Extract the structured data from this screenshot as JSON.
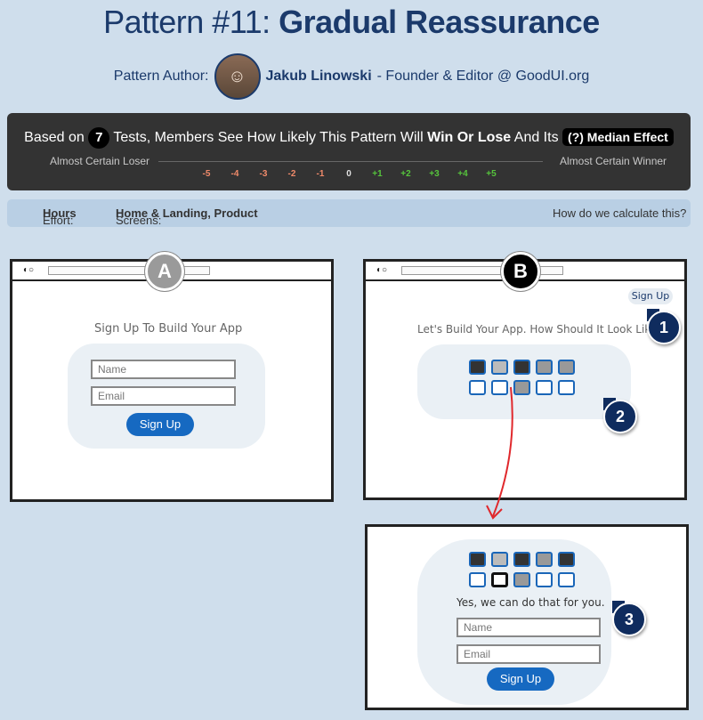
{
  "header": {
    "title_prefix": "Pattern #11:",
    "title_bold": "Gradual Reassurance",
    "author_label": "Pattern Author:",
    "author_name": "Jakub Linowski",
    "author_role": "- Founder & Editor @ GoodUI.org"
  },
  "stats": {
    "based_on": "Based on",
    "test_count": "7",
    "middle_text": "Tests, Members See How Likely This Pattern Will",
    "win_lose": "Win Or Lose",
    "and_its": "And Its",
    "median_label": "(?) Median Effect",
    "left_label": "Almost Certain Loser",
    "right_label": "Almost Certain Winner",
    "scale": [
      "-5",
      "-4",
      "-3",
      "-2",
      "-1",
      "0",
      "+1",
      "+2",
      "+3",
      "+4",
      "+5"
    ]
  },
  "effort": {
    "effort_label": "Effort:",
    "effort_value": "Hours",
    "screens_label": "Screens:",
    "screens_value": "Home & Landing, Product",
    "calc_link": "How do we calculate this?"
  },
  "variant_a": {
    "badge": "A",
    "headline": "Sign Up To Build Your App",
    "name_placeholder": "Name",
    "email_placeholder": "Email",
    "signup": "Sign Up"
  },
  "variant_b": {
    "badge": "B",
    "top_signup": "Sign Up",
    "headline": "Let's Build Your App. How Should It Look Like?",
    "step1": "1",
    "step2": "2",
    "step3": "3",
    "reassure": "Yes, we can do that for you.",
    "name_placeholder": "Name",
    "email_placeholder": "Email",
    "signup": "Sign Up"
  },
  "colors": {
    "accent": "#1b3a6b",
    "button": "#1669c1",
    "negative": "#f08a6a",
    "positive": "#56c43c"
  }
}
